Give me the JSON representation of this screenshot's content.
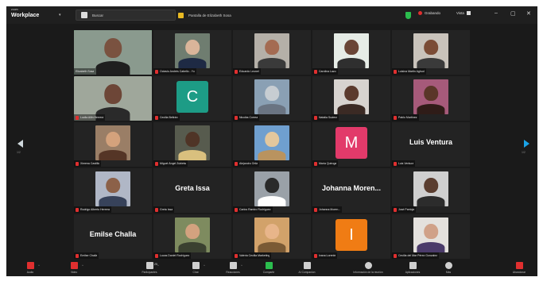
{
  "titlebar": {
    "brand_small": "zoom",
    "brand_big": "Workplace",
    "search_text": "Buscar",
    "channel_text": "Pantalla de Elizabeth Sosa",
    "recording_text": "Grabando",
    "view_text": "Vista",
    "minimize": "–",
    "maximize": "▢",
    "close": "✕"
  },
  "nav": {
    "left_page": "1/2",
    "right_page": "1/2"
  },
  "participants": [
    {
      "name": "Elizabeth Sosa",
      "kind": "video",
      "bg": "#8a9a8e",
      "face": "#7a5240",
      "shirt": "#1f1f1f",
      "speaking": true,
      "muted": false
    },
    {
      "name": "Octavio Andrés Cabello - Yu",
      "kind": "video",
      "bg": "#6f7d70",
      "face": "#d9b59a",
      "shirt": "#1e2a44",
      "speaking": false,
      "muted": true
    },
    {
      "name": "Eduardo Leonel",
      "kind": "video",
      "bg": "#b5b0a8",
      "face": "#a46b52",
      "shirt": "#3a3a3a",
      "speaking": false,
      "muted": true
    },
    {
      "name": "Carolina Lazo",
      "kind": "video",
      "bg": "#e6ece6",
      "face": "#6a4536",
      "shirt": "#2f2f2f",
      "speaking": false,
      "muted": true
    },
    {
      "name": "Luisina Martin Aghud",
      "kind": "video",
      "bg": "#c9c3bb",
      "face": "#7b4c36",
      "shirt": "#3a3a3a",
      "speaking": false,
      "muted": true
    },
    {
      "name": "Lucila Ailin Herrera",
      "kind": "video",
      "bg": "#9fa79b",
      "face": "#6d4637",
      "shirt": "#2a2a2a",
      "speaking": false,
      "muted": true
    },
    {
      "name": "Cecilia Beltrán",
      "kind": "avatar",
      "letter": "C",
      "bg_letter": "#1d9c86",
      "speaking": false,
      "muted": true
    },
    {
      "name": "Nicolás Correa",
      "kind": "video",
      "bg": "#8aa0b4",
      "face": "#c7cdd2",
      "shirt": "#6a7482",
      "speaking": false,
      "muted": true
    },
    {
      "name": "Natalia Suárez",
      "kind": "video",
      "bg": "#d7d3cf",
      "face": "#5b3a2d",
      "shirt": "#3b2a24",
      "speaking": false,
      "muted": true
    },
    {
      "name": "Pablo Martínez",
      "kind": "video",
      "bg": "#a65a7a",
      "face": "#5a3628",
      "shirt": "#2f1c18",
      "speaking": false,
      "muted": true
    },
    {
      "name": "Ximena Castillo",
      "kind": "video",
      "bg": "#9a7e66",
      "face": "#d4a27c",
      "shirt": "#553526",
      "speaking": false,
      "muted": true
    },
    {
      "name": "Miguel Ángel Zubieta",
      "kind": "video",
      "bg": "#575b4e",
      "face": "#4f3426",
      "shirt": "#d9c07e",
      "speaking": false,
      "muted": true
    },
    {
      "name": "Alejandro Ortiz",
      "kind": "video",
      "bg": "#6f9fcf",
      "face": "#e3c79d",
      "shirt": "#b9935f",
      "speaking": false,
      "muted": true
    },
    {
      "name": "María Quiroga",
      "kind": "avatar",
      "letter": "M",
      "bg_letter": "#e23a6a",
      "speaking": false,
      "muted": true
    },
    {
      "name": "Luis Ventura",
      "kind": "text",
      "big": "Luis Ventura",
      "speaking": false,
      "muted": true
    },
    {
      "name": "Rodrigo Alberto Herrera",
      "kind": "video",
      "bg": "#b0b7c6",
      "face": "#8c6149",
      "shirt": "#37425a",
      "speaking": false,
      "muted": true
    },
    {
      "name": "Greta Issa",
      "kind": "text",
      "big": "Greta Issa",
      "speaking": false,
      "muted": true
    },
    {
      "name": "Carlos Ramiro Rodríguez",
      "kind": "video",
      "bg": "#9aa1a8",
      "face": "#2a2a2a",
      "shirt": "#ffffff",
      "speaking": false,
      "muted": true
    },
    {
      "name": "Johanna Moren...",
      "kind": "text",
      "big": "Johanna Moren...",
      "speaking": false,
      "muted": true
    },
    {
      "name": "José Pantoja",
      "kind": "video",
      "bg": "#cfcfcf",
      "face": "#5a3d2f",
      "shirt": "#2c2c2c",
      "speaking": false,
      "muted": true
    },
    {
      "name": "Emilse Challa",
      "kind": "text",
      "big": "Emilse Challa",
      "speaking": false,
      "muted": true
    },
    {
      "name": "Lucas Daniel Rodríguez",
      "kind": "video",
      "bg": "#7e8b5f",
      "face": "#d3a27f",
      "shirt": "#3a4030",
      "speaking": false,
      "muted": true
    },
    {
      "name": "Valeria Cecilia Marketing",
      "kind": "video",
      "bg": "#d2a26a",
      "face": "#e8b58a",
      "shirt": "#7a5a35",
      "speaking": false,
      "muted": true
    },
    {
      "name": "Ivana Lorente",
      "kind": "avatar",
      "letter": "I",
      "bg_letter": "#f07c14",
      "speaking": false,
      "muted": true
    },
    {
      "name": "Cecilia del Mar Pérez Gonzalez",
      "kind": "video",
      "bg": "#e4e1dd",
      "face": "#d0a188",
      "shirt": "#4b3b6a",
      "speaking": false,
      "muted": true
    }
  ],
  "toolbar": {
    "items": [
      {
        "label": "Audio",
        "icon": "microphone-muted-icon",
        "color": "#e02f2f"
      },
      {
        "label": "Video",
        "icon": "camera-off-icon",
        "color": "#e02f2f"
      },
      {
        "label": "Participantes",
        "icon": "participants-icon",
        "color": "#cfcfcf"
      },
      {
        "label": "Chat",
        "icon": "chat-icon",
        "color": "#cfcfcf"
      },
      {
        "label": "Reacciones",
        "icon": "reactions-icon",
        "color": "#cfcfcf"
      },
      {
        "label": "Compartir",
        "icon": "share-screen-icon",
        "color": "#2bbd4e"
      },
      {
        "label": "AI Companion",
        "icon": "ai-companion-icon",
        "color": "#cfcfcf"
      },
      {
        "label": "Información de la reunión",
        "icon": "info-icon",
        "color": "#cfcfcf"
      },
      {
        "label": "Aplicaciones",
        "icon": "apps-icon",
        "color": "#cfcfcf"
      },
      {
        "label": "Más",
        "icon": "more-icon",
        "color": "#cfcfcf"
      },
      {
        "label": "Abandonar",
        "icon": "leave-icon",
        "color": "#e02f2f"
      }
    ],
    "participants_count": "25"
  }
}
